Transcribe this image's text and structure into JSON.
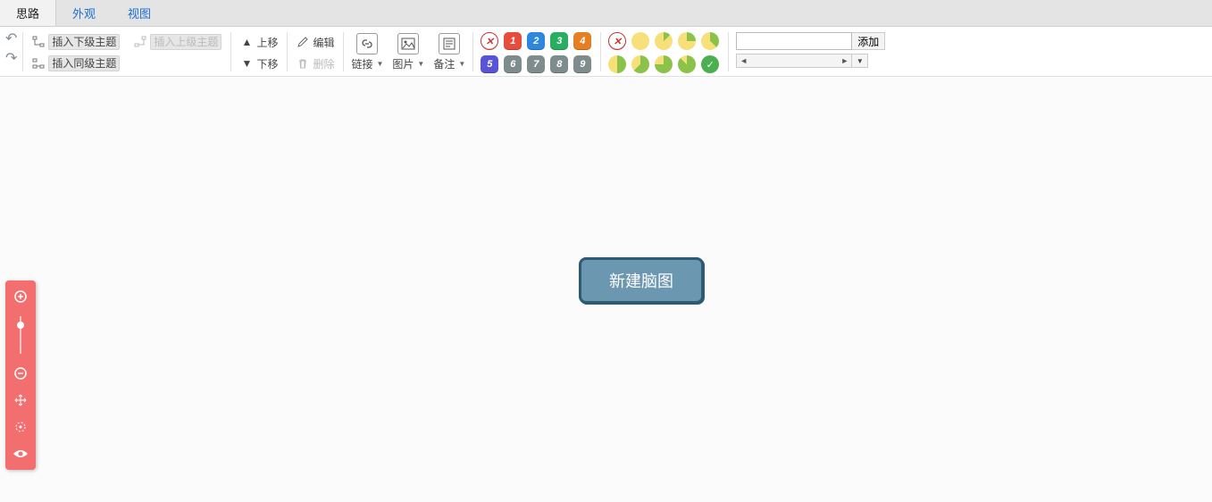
{
  "tabs": {
    "t0": "思路",
    "t1": "外观",
    "t2": "视图"
  },
  "history": {
    "undo": "↶",
    "redo": "↷"
  },
  "insert": {
    "child": "插入下级主题",
    "parent": "插入上级主题",
    "sibling": "插入同级主题"
  },
  "move": {
    "up": "上移",
    "down": "下移"
  },
  "edit": {
    "edit": "编辑",
    "del": "删除"
  },
  "big": {
    "link": "链接",
    "image": "图片",
    "note": "备注"
  },
  "priority": {
    "p1": "1",
    "p2": "2",
    "p3": "3",
    "p4": "4",
    "p5": "5",
    "p6": "6",
    "p7": "7",
    "p8": "8",
    "p9": "9"
  },
  "resource": {
    "add": "添加",
    "value": ""
  },
  "root": {
    "label": "新建脑图"
  },
  "colors": {
    "p1": "#e64d3d",
    "p2": "#2e86de",
    "p3": "#27ae60",
    "p4": "#e67e22",
    "p5": "#5b53d6",
    "p6": "#7f8c8d",
    "p7": "#7f8c8d",
    "p8": "#7f8c8d",
    "p9": "#7f8c8d",
    "prog_empty": "#f7e07a",
    "prog_ring": "#8bc34a",
    "prog_done": "#4caf50"
  }
}
